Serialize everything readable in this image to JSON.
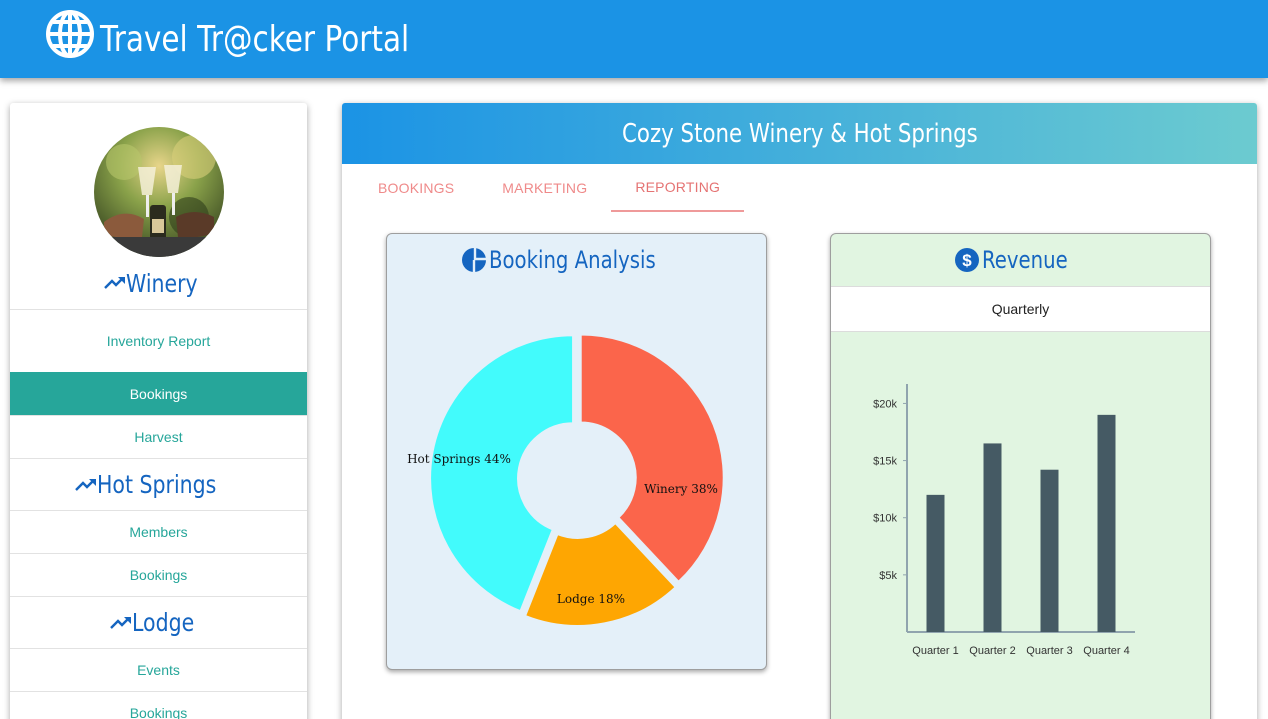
{
  "header": {
    "title": "Travel Tr@cker Portal",
    "icon": "globe-icon"
  },
  "sidebar": {
    "sections": [
      {
        "title": "Winery",
        "items": [
          {
            "label": "Inventory Report",
            "active": false
          },
          {
            "label": "Bookings",
            "active": true
          },
          {
            "label": "Harvest",
            "active": false
          }
        ]
      },
      {
        "title": "Hot Springs",
        "items": [
          {
            "label": "Members",
            "active": false
          },
          {
            "label": "Bookings",
            "active": false
          }
        ]
      },
      {
        "title": "Lodge",
        "items": [
          {
            "label": "Events",
            "active": false
          },
          {
            "label": "Bookings",
            "active": false
          }
        ]
      }
    ]
  },
  "main": {
    "title": "Cozy Stone Winery & Hot Springs",
    "tabs": [
      {
        "label": "BOOKINGS",
        "active": false
      },
      {
        "label": "MARKETING",
        "active": false
      },
      {
        "label": "REPORTING",
        "active": true
      }
    ]
  },
  "booking_panel": {
    "title": "Booking Analysis",
    "icon": "pie-chart-icon"
  },
  "revenue_panel": {
    "title": "Revenue",
    "icon": "dollar-icon",
    "period": "Quarterly"
  },
  "colors": {
    "header": "#1b93e5",
    "accent": "#26a69a",
    "heading": "#1565c0",
    "tab": "#e57373"
  },
  "chart_data": [
    {
      "type": "pie",
      "title": "",
      "categories": [
        "Winery",
        "Lodge",
        "Hot Springs"
      ],
      "values": [
        38,
        18,
        44
      ],
      "labels": [
        "Winery 38%",
        "Lodge 18%",
        "Hot Springs 44%"
      ],
      "colors": [
        "#fb654b",
        "#fea602",
        "#42fbfc"
      ]
    },
    {
      "type": "bar",
      "title": "",
      "categories": [
        "Quarter 1",
        "Quarter 2",
        "Quarter 3",
        "Quarter 4"
      ],
      "values": [
        12000,
        16500,
        14200,
        19000
      ],
      "ylim": [
        0,
        21000
      ],
      "yticks": [
        5000,
        10000,
        15000,
        20000
      ],
      "ytick_labels": [
        "$5k",
        "$10k",
        "$15k",
        "$20k"
      ],
      "color": "#455a64"
    }
  ]
}
